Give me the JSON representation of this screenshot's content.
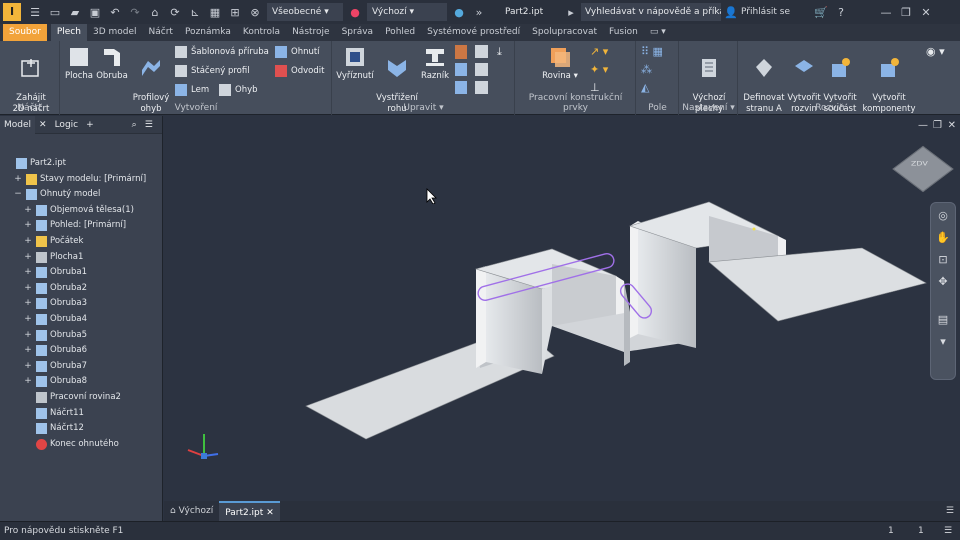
{
  "qat": {
    "style_value": "Všeobecné",
    "appearance_value": "Výchozí",
    "doc_title": "Part2.ipt",
    "help_search": "Vyhledávat v nápovědě a příkaze",
    "signin": "Přihlásit se"
  },
  "tabs": [
    "Soubor",
    "Plech",
    "3D model",
    "Náčrt",
    "Poznámka",
    "Kontrola",
    "Nástroje",
    "Správa",
    "Pohled",
    "Systémové prostředí",
    "Spolupracovat",
    "Fusion"
  ],
  "ribbon": {
    "sketch": {
      "start_2d": "Zahájit\n2D náčrt",
      "label": "Náčrt"
    },
    "create": {
      "label": "Vytvoření",
      "plocha": "Plocha",
      "obruba": "Obruba",
      "profil": "Profilový\nohyb",
      "sablon": "Šablonová příruba",
      "staceny": "Stáčený profil",
      "lem": "Lem",
      "ohyb": "Ohyb",
      "ohnuti": "Ohnutí",
      "odvodit": "Odvodit"
    },
    "modify": {
      "label": "Upravit",
      "vyriznuti": "Vyříznutí",
      "vystrizeni": "Vystřižení\nrohu",
      "raznik": "Razník"
    },
    "work": {
      "label": "Pracovní konstrukční prvky",
      "rovina": "Rovina"
    },
    "pattern": {
      "label": "Pole"
    },
    "setup": {
      "label": "Nastavení",
      "defaults": "Výchozí\nplechy"
    },
    "flat": {
      "label": "Rozvin",
      "defA": "Definovat\nstranu A",
      "vrozvin": "Vytvořit\nrozvin",
      "vsoucast": "Vytvořit\nsoučást",
      "vkomp": "Vytvořit\nkomponenty"
    }
  },
  "browser": {
    "tab_model": "Model",
    "tab_logic": "Logic",
    "nodes": [
      {
        "label": "Part2.ipt",
        "icon": "part-icon"
      },
      {
        "label": "Stavy modelu: [Primární]",
        "icon": "folder-icon"
      },
      {
        "label": "Ohnutý model",
        "icon": "folded-model-icon"
      },
      {
        "label": "Objemová tělesa(1)",
        "icon": "solid-bodies-icon"
      },
      {
        "label": "Pohled: [Primární]",
        "icon": "view-icon"
      },
      {
        "label": "Počátek",
        "icon": "origin-icon"
      },
      {
        "label": "Plocha1",
        "icon": "face-icon"
      },
      {
        "label": "Obruba1",
        "icon": "flange-icon"
      },
      {
        "label": "Obruba2",
        "icon": "flange-icon"
      },
      {
        "label": "Obruba3",
        "icon": "flange-icon"
      },
      {
        "label": "Obruba4",
        "icon": "flange-icon"
      },
      {
        "label": "Obruba5",
        "icon": "flange-icon"
      },
      {
        "label": "Obruba6",
        "icon": "flange-icon"
      },
      {
        "label": "Obruba7",
        "icon": "flange-icon"
      },
      {
        "label": "Obruba8",
        "icon": "flange-icon"
      },
      {
        "label": "Pracovní rovina2",
        "icon": "work-plane-icon"
      },
      {
        "label": "Náčrt11",
        "icon": "sketch-icon"
      },
      {
        "label": "Náčrt12",
        "icon": "sketch-icon"
      },
      {
        "label": "Konec ohnutého",
        "icon": "end-of-part-icon"
      }
    ]
  },
  "doctabs": {
    "home": "Výchozí",
    "part": "Part2.ipt"
  },
  "status": {
    "hint": "Pro nápovědu stiskněte F1",
    "count1": "1",
    "count2": "1"
  },
  "viewcube": {
    "face": "ZDV"
  }
}
